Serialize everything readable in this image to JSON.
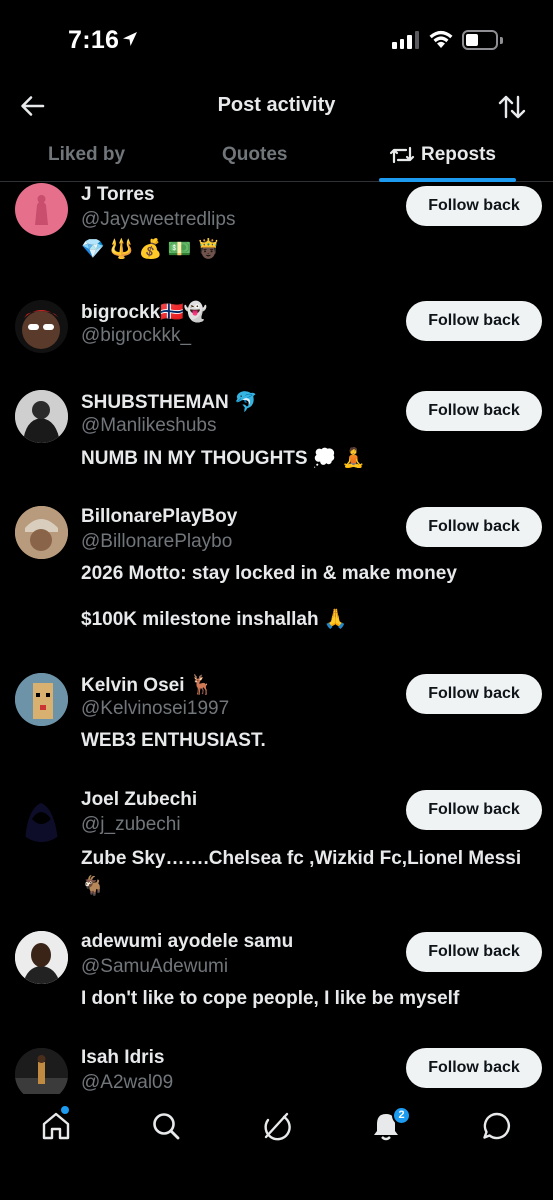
{
  "status": {
    "time": "7:16"
  },
  "header": {
    "title": "Post activity"
  },
  "tabs": [
    {
      "label": "Liked by"
    },
    {
      "label": "Quotes"
    },
    {
      "label": "Reposts",
      "active": true
    }
  ],
  "users": [
    {
      "name": "J Torres",
      "handle": "@Jaysweetredlips",
      "bio": "💎 🔱 💰 💵 🤴🏿",
      "button": "Follow back"
    },
    {
      "name": "bigrockk🇳🇴👻",
      "handle": "@bigrockkk_",
      "bio": "",
      "button": "Follow back"
    },
    {
      "name": "SHUBSTHEMAN 🐬",
      "handle": "@Manlikeshubs",
      "bio": "NUMB IN MY THOUGHTS 💭 🧘",
      "button": "Follow back"
    },
    {
      "name": "BillonarePlayBoy",
      "handle": "@BillonarePlaybo",
      "bio_line1": "2026 Motto: stay locked in & make money",
      "bio_line2": "$100K milestone inshallah 🙏",
      "button": "Follow back"
    },
    {
      "name": "Kelvin Osei 🦌",
      "handle": "@Kelvinosei1997",
      "bio": "WEB3 ENTHUSIAST.",
      "button": "Follow back"
    },
    {
      "name": "Joel Zubechi",
      "handle": "@j_zubechi",
      "bio": "Zube Sky…….Chelsea fc ,Wizkid Fc,Lionel Messi 🐐",
      "button": "Follow back"
    },
    {
      "name": "adewumi ayodele samu",
      "handle": "@SamuAdewumi",
      "bio": "I don't like to cope people, I like be myself",
      "button": "Follow back"
    },
    {
      "name": "Isah Idris",
      "handle": "@A2wal09",
      "bio": "",
      "button": "Follow back"
    }
  ],
  "nav": {
    "notifications_count": "2"
  },
  "colors": {
    "accent": "#1d9bf0",
    "background": "#000000",
    "secondary_text": "#71767b",
    "button_bg": "#eff3f4"
  },
  "icons": [
    "back-arrow-icon",
    "sort-icon",
    "repost-icon",
    "home-icon",
    "search-icon",
    "grok-icon",
    "bell-icon",
    "messages-icon"
  ]
}
